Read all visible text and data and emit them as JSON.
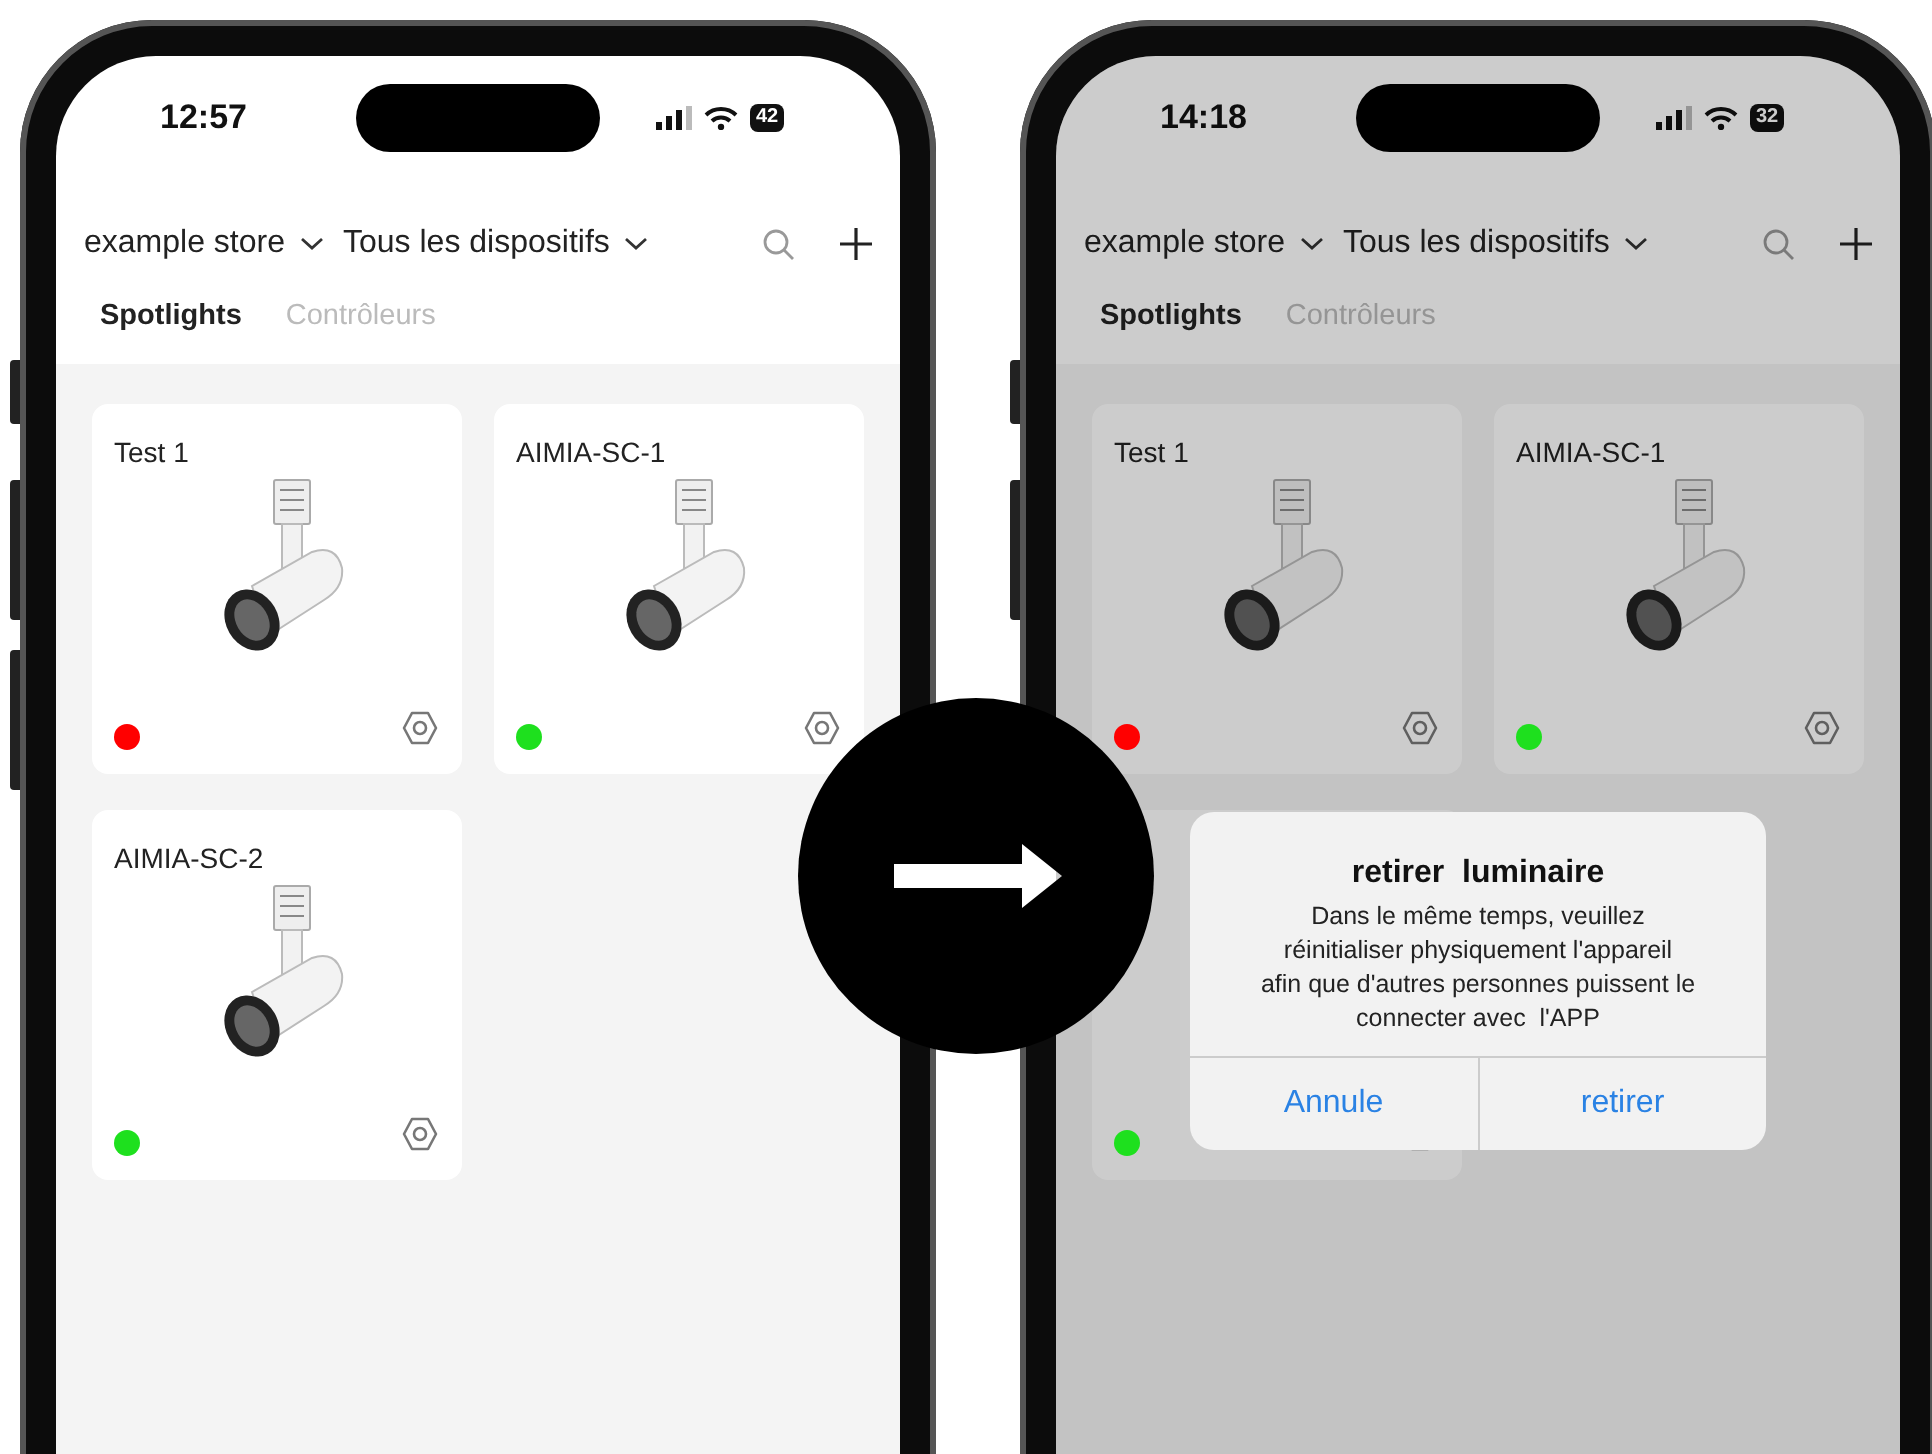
{
  "screens": [
    {
      "status_bar": {
        "time": "12:57",
        "battery": "42"
      },
      "store_selector": "example store",
      "device_filter": "Tous les dispositifs",
      "tabs": [
        {
          "label": "Spotlights",
          "selected": true
        },
        {
          "label": "Contrôleurs",
          "selected": false
        }
      ],
      "devices": [
        {
          "name": "Test 1",
          "color": "#ff0000"
        },
        {
          "name": "AIMIA-SC-1",
          "color": "#1ee01e"
        },
        {
          "name": "AIMIA-SC-2",
          "color": "#1ee01e"
        }
      ]
    },
    {
      "status_bar": {
        "time": "14:18",
        "battery": "32"
      },
      "store_selector": "example store",
      "device_filter": "Tous les dispositifs",
      "tabs": [
        {
          "label": "Spotlights",
          "selected": true
        },
        {
          "label": "Contrôleurs",
          "selected": false
        }
      ],
      "devices": [
        {
          "name": "Test 1",
          "color": "#ff0000"
        },
        {
          "name": "AIMIA-SC-1",
          "color": "#1ee01e"
        },
        {
          "color": "#1ee01e"
        }
      ],
      "dialog": {
        "title": "retirer  luminaire",
        "message": "Dans le même temps, veuillez\nréinitialiser physiquement l'appareil\nafin que d'autres personnes puissent le\nconnecter avec  l'APP",
        "buttons": [
          "Annule",
          "retirer"
        ]
      }
    }
  ]
}
